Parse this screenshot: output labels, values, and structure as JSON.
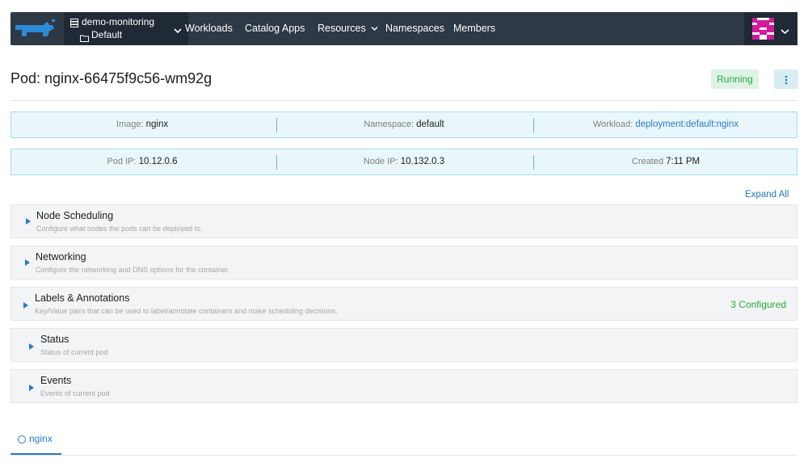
{
  "topbar": {
    "cluster_name": "demo-monitoring",
    "project_name": "Default",
    "nav": [
      "Workloads",
      "Catalog Apps",
      "Resources",
      "Namespaces",
      "Members"
    ],
    "icons": {
      "logo": "rancher-logo-icon",
      "cluster": "server-icon",
      "project": "folder-icon",
      "dropdown": "chevron-down-icon",
      "avatar": "user-avatar-icon"
    },
    "colors": {
      "bar": "#2d3945",
      "bar_dark": "#1f2a35",
      "logo": "#2d8ad7",
      "avatar": "#d3199c"
    }
  },
  "header": {
    "title": "Pod: nginx-66475f9c56-wm92g",
    "status": "Running",
    "status_color": "#27a844",
    "menu_icon": "kebab-menu-icon"
  },
  "info_row1": {
    "image_label": "Image:",
    "image_value": "nginx",
    "namespace_label": "Namespace:",
    "namespace_value": "default",
    "workload_label": "Workload:",
    "workload_value": "deployment:default:nginx"
  },
  "info_row2": {
    "pod_ip_label": "Pod IP:",
    "pod_ip_value": "10.12.0.6",
    "node_ip_label": "Node IP:",
    "node_ip_value": "10.132.0.3",
    "created_label": "Created",
    "created_value": "7:11 PM"
  },
  "expand_all": "Expand All",
  "sections": [
    {
      "title": "Node Scheduling",
      "description": "Configure what nodes the pods can be deployed to.",
      "count": ""
    },
    {
      "title": "Networking",
      "description": "Configure the networking and DNS options for the container.",
      "count": ""
    },
    {
      "title": "Labels & Annotations",
      "description": "Key/Value pairs that can be used to label/annotate containers and make scheduling decisions.",
      "count": "3 Configured"
    },
    {
      "title": "Status",
      "description": "Status of current pod",
      "count": ""
    },
    {
      "title": "Events",
      "description": "Events of current pod",
      "count": ""
    }
  ],
  "tabs": [
    {
      "label": "nginx",
      "icon": "circle-icon"
    }
  ],
  "accent_color": "#2879c6"
}
